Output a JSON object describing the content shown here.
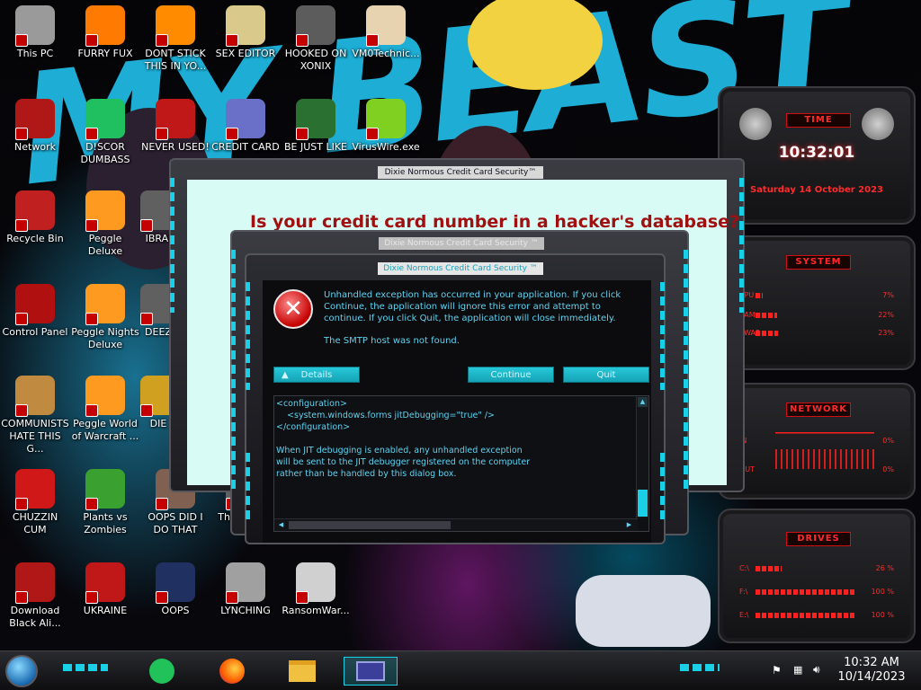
{
  "desktop": {
    "icons": [
      {
        "label": "This PC",
        "icon": "computer-icon",
        "color": "#9a9a9a"
      },
      {
        "label": "FURRY FUX",
        "icon": "firefox-icon",
        "color": "#ff7a00"
      },
      {
        "label": "DONT STICK THIS IN YO...",
        "icon": "vlc-cone-icon",
        "color": "#ff8c00"
      },
      {
        "label": "SEX EDITOR",
        "icon": "hxd-icon",
        "color": "#d9c98a"
      },
      {
        "label": "HOOKED ON XONIX",
        "icon": "xonix-icon",
        "color": "#5c5c5c"
      },
      {
        "label": "VM0Technic...",
        "icon": "doctor-icon",
        "color": "#e8d3b0"
      },
      {
        "label": "Network",
        "icon": "alien-orb-icon",
        "color": "#b01818"
      },
      {
        "label": "D!SCOR DUMBASS",
        "icon": "green-app-icon",
        "color": "#20c060"
      },
      {
        "label": "NEVER USED!",
        "icon": "dev-cpp-icon",
        "color": "#c01818"
      },
      {
        "label": "CREDIT CARD",
        "icon": "credit-card-icon",
        "color": "#6a70c8"
      },
      {
        "label": "BE JUST LIKE",
        "icon": "santa-icon",
        "color": "#2a7030"
      },
      {
        "label": "VirusWire.exe",
        "icon": "lime-icon",
        "color": "#7fd020"
      },
      {
        "label": "Recycle Bin",
        "icon": "recycle-bin-icon",
        "color": "#c02020"
      },
      {
        "label": "Peggle Deluxe",
        "icon": "peggle-icon",
        "color": "#ff9a20"
      },
      {
        "label": "IBRAI",
        "icon": "partial-icon",
        "color": "#606060"
      },
      {
        "label": "Control Panel",
        "icon": "control-panel-icon",
        "color": "#b01010"
      },
      {
        "label": "Peggle Nights Deluxe",
        "icon": "peggle-nights-icon",
        "color": "#ff9a20"
      },
      {
        "label": "DEEZ",
        "icon": "partial-icon",
        "color": "#606060"
      },
      {
        "label": "COMMUNISTS HATE THIS G...",
        "icon": "money-bag-icon",
        "color": "#c08a40"
      },
      {
        "label": "Peggle World of Warcraft ...",
        "icon": "peggle-wow-icon",
        "color": "#ff9a20"
      },
      {
        "label": "DIE",
        "icon": "partial-icon",
        "color": "#d0a020"
      },
      {
        "label": "CHUZZIN CUM",
        "icon": "chuzzle-icon",
        "color": "#d01818"
      },
      {
        "label": "Plants vs Zombies",
        "icon": "pvz-icon",
        "color": "#3aa030"
      },
      {
        "label": "OOPS DID I DO THAT",
        "icon": "portrait-icon",
        "color": "#806050"
      },
      {
        "label": "The Le... ZI",
        "icon": "partial-icon",
        "color": "#606060"
      },
      {
        "label": "Download Black Ali...",
        "icon": "alien-orb-icon",
        "color": "#b01818"
      },
      {
        "label": "UKRAINE",
        "icon": "radiation-icon",
        "color": "#c01818"
      },
      {
        "label": "OOPS",
        "icon": "oops-icon",
        "color": "#203060"
      },
      {
        "label": "LYNCHING",
        "icon": "lynching-icon",
        "color": "#a0a0a0"
      },
      {
        "label": "RansomWar...",
        "icon": "skull-icon",
        "color": "#d0d0d0"
      }
    ]
  },
  "bg_dialog": {
    "title": "Dixie Normous Credit Card Security™",
    "headline": "Is your credit card number in a hacker's database?"
  },
  "mid_dialog": {
    "title": "Dixie Normous Credit Card Security ™"
  },
  "error_dialog": {
    "title": "Dixie Normous Credit Card Security ™",
    "message": "Unhandled exception has occurred in your application. If you click Continue, the application will ignore this error and attempt to continue. If you click Quit, the application will close immediately.",
    "detail": "The SMTP host was not found.",
    "details_button": "Details",
    "continue_button": "Continue",
    "quit_button": "Quit",
    "details_lines": [
      "<configuration>",
      "    <system.windows.forms jitDebugging=\"true\" />",
      "</configuration>",
      "",
      "When JIT debugging is enabled, any unhandled exception",
      "will be sent to the JIT debugger registered on the computer",
      "rather than be handled by this dialog box."
    ]
  },
  "gadgets": {
    "time": {
      "heading": "TIME",
      "clock": "10:32:01",
      "date": "Saturday 14 October 2023"
    },
    "system": {
      "heading": "SYSTEM",
      "rows": [
        {
          "label": "CPU",
          "value": "7%",
          "level": 0.07
        },
        {
          "label": "RAM",
          "value": "22%",
          "level": 0.22
        },
        {
          "label": "SWAP",
          "value": "23%",
          "level": 0.23
        }
      ]
    },
    "network": {
      "heading": "NETWORK",
      "rows": [
        {
          "label": "IN",
          "value": "0%"
        },
        {
          "label": "OUT",
          "value": "0%"
        }
      ]
    },
    "drives": {
      "heading": "DRIVES",
      "rows": [
        {
          "label": "C:\\",
          "value": "26 %",
          "level": 0.26
        },
        {
          "label": "F:\\",
          "value": "100 %",
          "level": 1.0
        },
        {
          "label": "E:\\",
          "value": "100 %",
          "level": 1.0
        }
      ]
    }
  },
  "taskbar": {
    "clock_time": "10:32 AM",
    "clock_date": "10/14/2023",
    "pinned": [
      {
        "icon": "green-app-icon"
      },
      {
        "icon": "firefox-icon"
      },
      {
        "icon": "file-explorer-icon"
      },
      {
        "icon": "credit-card-icon",
        "active": true
      }
    ],
    "tray": [
      {
        "icon": "flag-icon"
      },
      {
        "icon": "network-icon"
      },
      {
        "icon": "volume-icon"
      }
    ]
  },
  "colors": {
    "accent_cyan": "#1ad0e6",
    "alert_red": "#ff2a2a",
    "headline_red": "#a01010"
  }
}
